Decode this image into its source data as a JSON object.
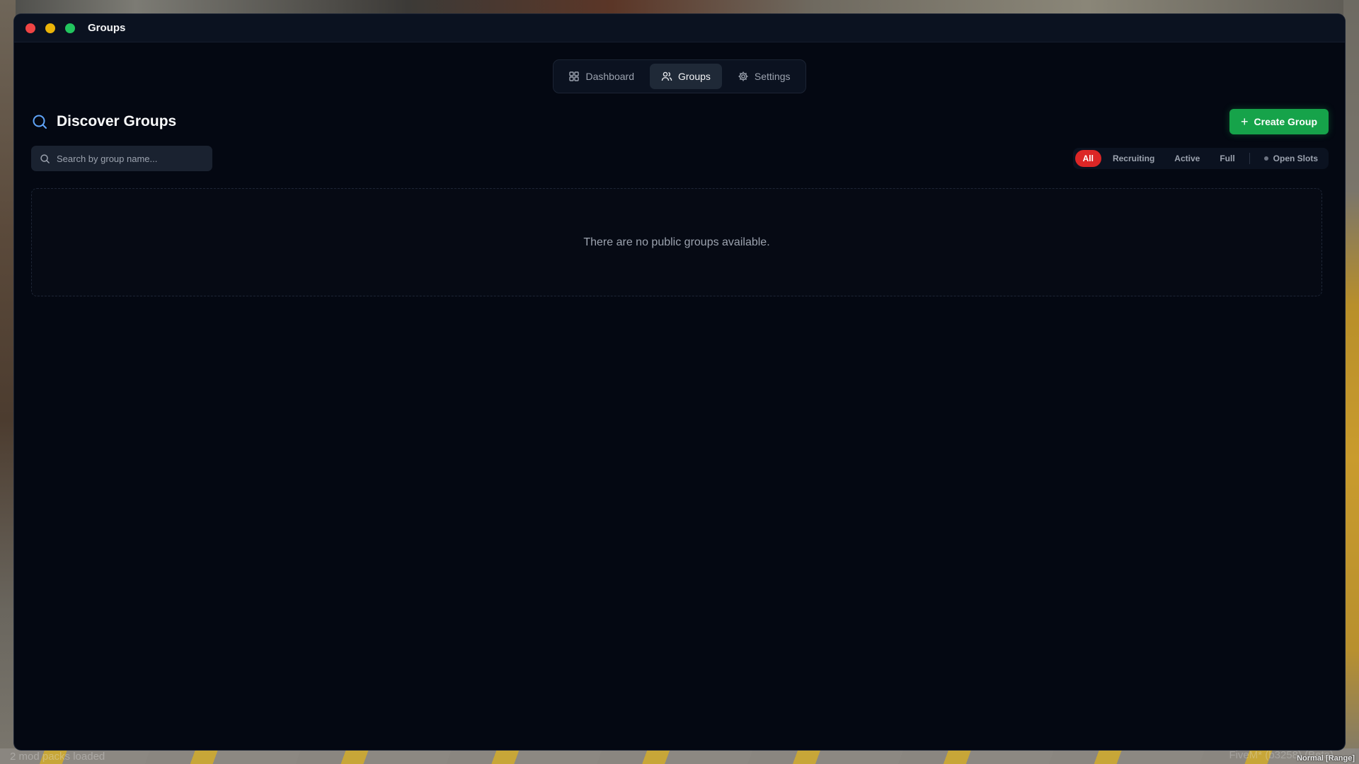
{
  "window": {
    "title": "Groups"
  },
  "nav": {
    "tabs": [
      {
        "label": "Dashboard",
        "icon": "grid-icon",
        "active": false
      },
      {
        "label": "Groups",
        "icon": "users-icon",
        "active": true
      },
      {
        "label": "Settings",
        "icon": "gear-icon",
        "active": false
      }
    ]
  },
  "page": {
    "title": "Discover Groups",
    "create_label": "Create Group"
  },
  "search": {
    "placeholder": "Search by group name..."
  },
  "filters": {
    "items": [
      {
        "label": "All",
        "active": true
      },
      {
        "label": "Recruiting",
        "active": false
      },
      {
        "label": "Active",
        "active": false
      },
      {
        "label": "Full",
        "active": false
      }
    ],
    "open_slots_label": "Open Slots"
  },
  "empty_state": {
    "message": "There are no public groups available."
  },
  "overlay": {
    "left_text": "2 mod packs loaded",
    "right_text": "FiveM* (b3258) (Beta)",
    "mode_text": "Normal [Range]"
  },
  "colors": {
    "accent_green": "#16a34a",
    "accent_red": "#dc2626",
    "search_icon_blue": "#60a5fa"
  }
}
